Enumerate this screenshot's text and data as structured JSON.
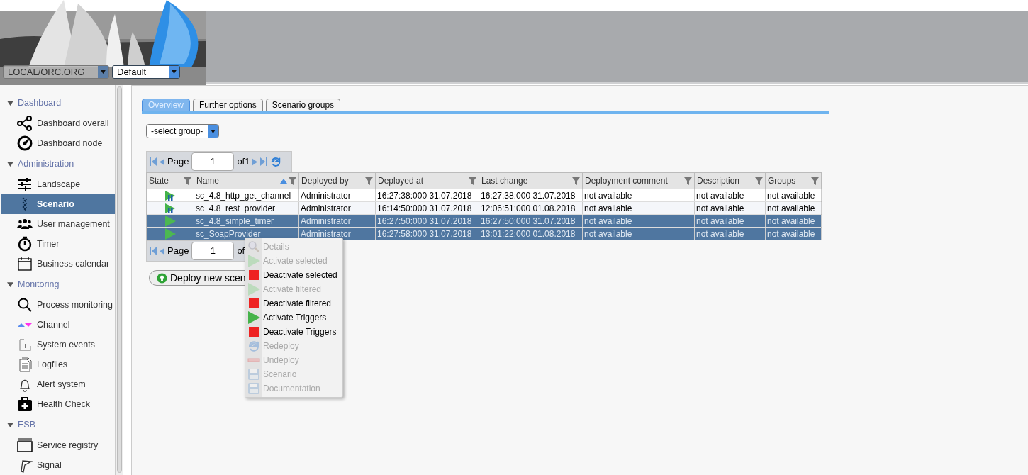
{
  "header": {
    "environment_select": {
      "value": "LOCAL/ORC.ORG"
    },
    "profile_select": {
      "value": "Default"
    }
  },
  "sidebar": {
    "sections": [
      {
        "title": "Dashboard",
        "expanded": true,
        "items": [
          {
            "label": "Dashboard overall",
            "kind": "graph",
            "selected": false
          },
          {
            "label": "Dashboard node",
            "kind": "gauge",
            "selected": false
          }
        ]
      },
      {
        "title": "Administration",
        "expanded": true,
        "items": [
          {
            "label": "Landscape",
            "kind": "sliders",
            "selected": false
          },
          {
            "label": "Scenario",
            "kind": "dots",
            "selected": true
          },
          {
            "label": "User management",
            "kind": "users",
            "selected": false
          },
          {
            "label": "Timer",
            "kind": "timer",
            "selected": false
          },
          {
            "label": "Business calendar",
            "kind": "calendar",
            "selected": false
          }
        ]
      },
      {
        "title": "Monitoring",
        "expanded": true,
        "items": [
          {
            "label": "Process monitoring",
            "kind": "search",
            "selected": false
          },
          {
            "label": "Channel",
            "kind": "channel",
            "selected": false
          },
          {
            "label": "System events",
            "kind": "info",
            "selected": false
          },
          {
            "label": "Logfiles",
            "kind": "file",
            "selected": false
          },
          {
            "label": "Alert system",
            "kind": "bell",
            "selected": false
          },
          {
            "label": "Health Check",
            "kind": "medkit",
            "selected": false
          }
        ]
      },
      {
        "title": "ESB",
        "expanded": true,
        "items": [
          {
            "label": "Service registry",
            "kind": "window",
            "selected": false
          },
          {
            "label": "Signal",
            "kind": "signal",
            "selected": false
          }
        ]
      }
    ]
  },
  "tabs": [
    {
      "label": "Overview",
      "selected": true
    },
    {
      "label": "Further options",
      "selected": false
    },
    {
      "label": "Scenario groups",
      "selected": false
    }
  ],
  "group_select": {
    "value": "-select group-"
  },
  "pager_top": {
    "page_label": "Page",
    "page": "1",
    "of": "of1"
  },
  "table": {
    "columns": [
      {
        "label": "State",
        "sorted": false
      },
      {
        "label": "Name",
        "sorted": true
      },
      {
        "label": "Deployed by",
        "sorted": false
      },
      {
        "label": "Deployed at",
        "sorted": false
      },
      {
        "label": "Last change",
        "sorted": false
      },
      {
        "label": "Deployment comment",
        "sorted": false
      },
      {
        "label": "Description",
        "sorted": false
      },
      {
        "label": "Groups",
        "sorted": false
      }
    ],
    "rows": [
      {
        "selected": false,
        "kind": "triggers",
        "name": "sc_4.8_http_get_channel",
        "deployed_by": "Administrator",
        "deployed_at": "16:27:38:000 31.07.2018",
        "last_change": "16:27:38:000 31.07.2018",
        "deployment_comment": "not available",
        "description": "not available",
        "groups": "not available"
      },
      {
        "selected": false,
        "kind": "triggers",
        "name": "sc_4.8_rest_provider",
        "deployed_by": "Administrator",
        "deployed_at": "16:14:50:000 31.07.2018",
        "last_change": "12:06:51:000 01.08.2018",
        "deployment_comment": "not available",
        "description": "not available",
        "groups": "not available"
      },
      {
        "selected": true,
        "kind": "active",
        "name": "sc_4.8_simple_timer",
        "deployed_by": "Administrator",
        "deployed_at": "16:27:50:000 31.07.2018",
        "last_change": "16:27:50:000 31.07.2018",
        "deployment_comment": "not available",
        "description": "not available",
        "groups": "not available"
      },
      {
        "selected": true,
        "kind": "active",
        "name": "sc_SoapProvider",
        "deployed_by": "Administrator",
        "deployed_at": "16:27:58:000 31.07.2018",
        "last_change": "13:01:22:000 01.08.2018",
        "deployment_comment": "not available",
        "description": "not available",
        "groups": "not available"
      }
    ]
  },
  "pager_bottom": {
    "page_label": "Page",
    "page": "1",
    "of": "of"
  },
  "deploy_button": {
    "label": "Deploy new scen"
  },
  "context_menu": [
    {
      "label": "Details",
      "kind": "details",
      "disabled": true
    },
    {
      "label": "Activate selected",
      "kind": "play",
      "disabled": true
    },
    {
      "label": "Deactivate selected",
      "kind": "stop",
      "disabled": false
    },
    {
      "label": "Activate filtered",
      "kind": "play",
      "disabled": true
    },
    {
      "label": "Deactivate filtered",
      "kind": "stop",
      "disabled": false
    },
    {
      "label": "Activate Triggers",
      "kind": "play",
      "disabled": false
    },
    {
      "label": "Deactivate Triggers",
      "kind": "stop",
      "disabled": false
    },
    {
      "label": "Redeploy",
      "kind": "redeploy",
      "disabled": true
    },
    {
      "label": "Undeploy",
      "kind": "undeploy",
      "disabled": true
    },
    {
      "label": "Scenario",
      "kind": "save",
      "disabled": true
    },
    {
      "label": "Documentation",
      "kind": "save",
      "disabled": true
    }
  ]
}
